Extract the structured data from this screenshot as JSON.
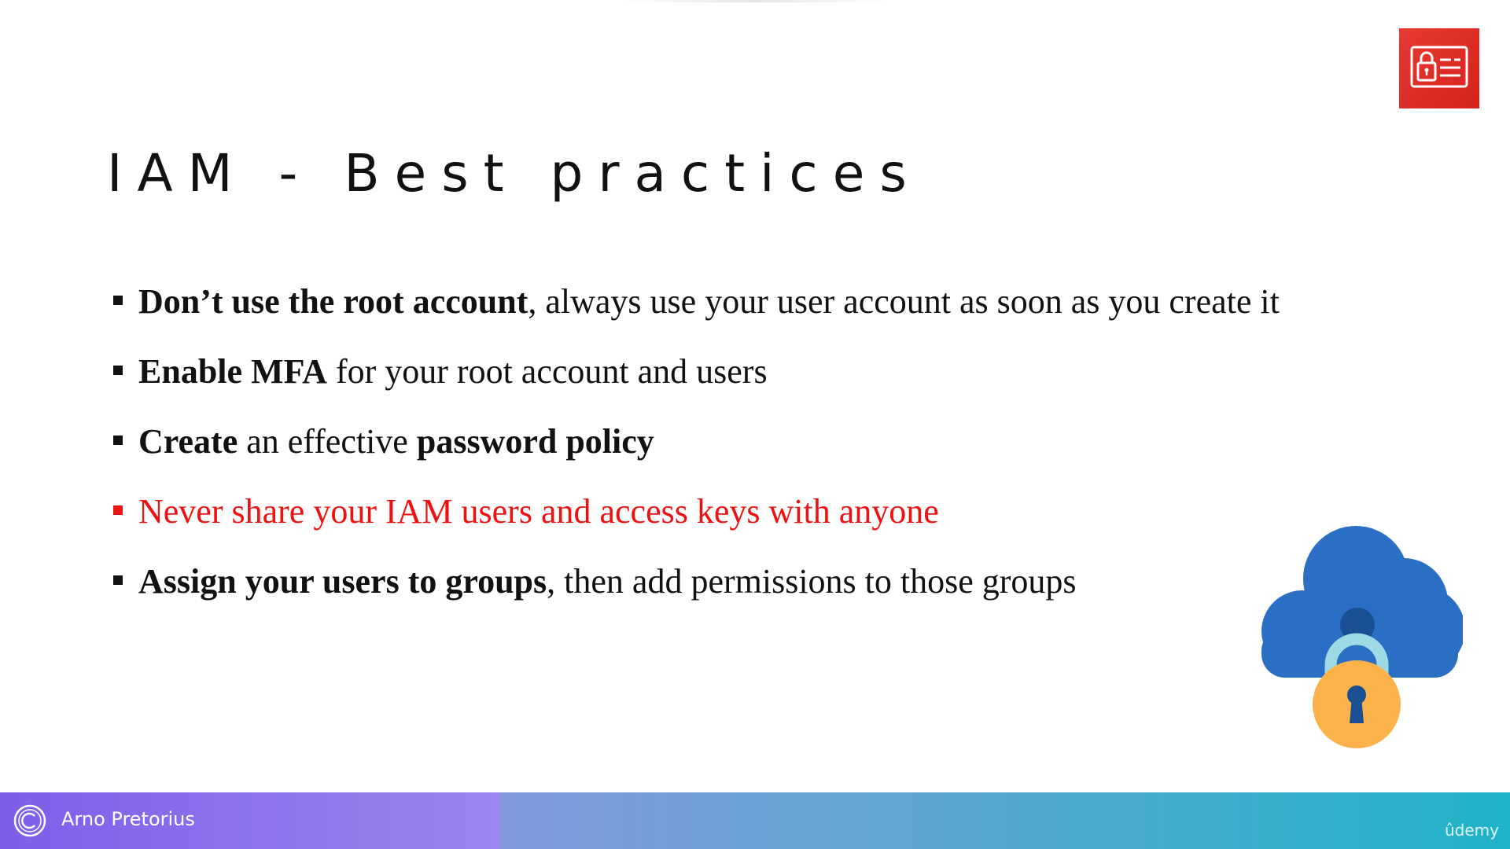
{
  "slide": {
    "title": "IAM - Best practices",
    "bullets": [
      {
        "bold": "Don’t use the root account",
        "text": ", always use your user account as soon as you create it"
      },
      {
        "bold": "Enable MFA",
        "text": " for your root account and users"
      },
      {
        "bold_1": "Create",
        "text_1": " an effective ",
        "bold_2": "password policy"
      },
      {
        "text": "Never share your IAM users and access keys with anyone"
      },
      {
        "bold": "Assign your users to groups",
        "text": ", then add permissions to those groups"
      }
    ]
  },
  "icons": {
    "top_right": "iam-identity-icon",
    "illustration": "cloud-lock-icon",
    "footer": "copyright-icon"
  },
  "colors": {
    "highlight": "#ee1111",
    "badge": "#e02a26",
    "cloud": "#2b6fc4",
    "lock": "#fbb24a",
    "shackle": "#9fd9e6"
  },
  "footer": {
    "author": "Arno Pretorius",
    "brand": "ûdemy"
  }
}
